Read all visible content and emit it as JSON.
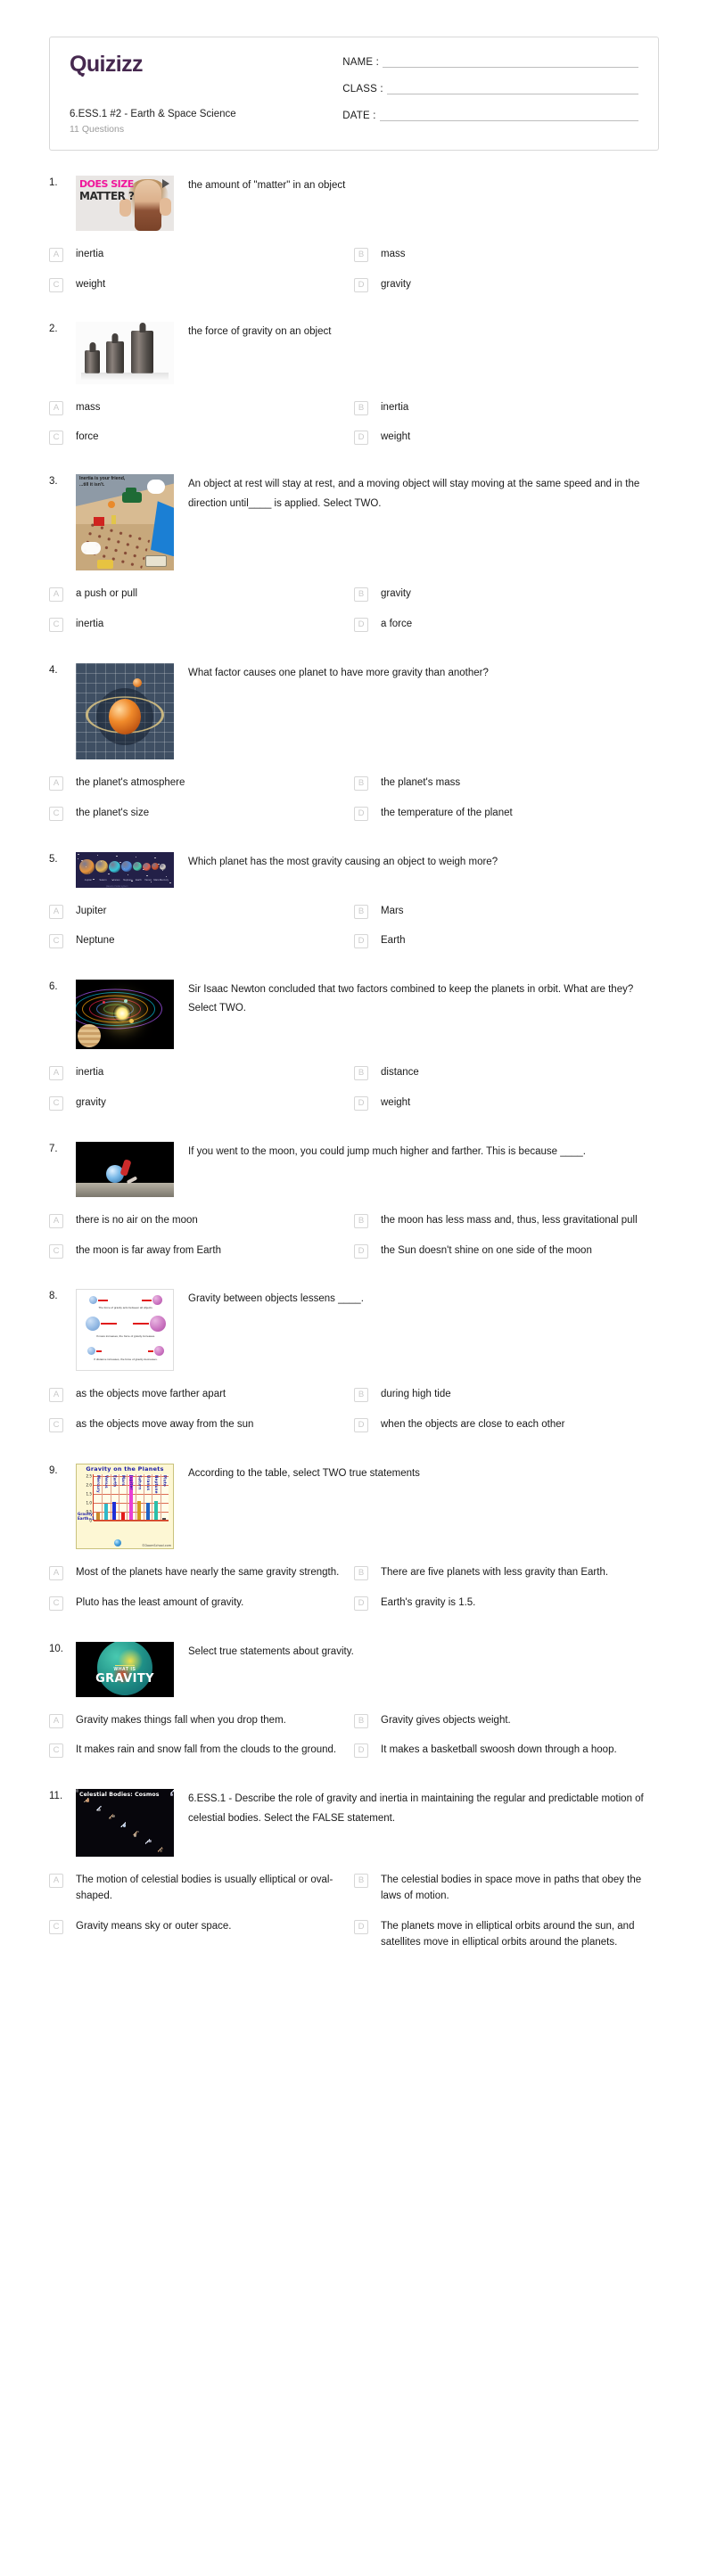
{
  "header": {
    "brand": "Quizizz",
    "quiz_title": "6.ESS.1 #2 - Earth & Space Science",
    "question_count_label": "11 Questions",
    "fields": [
      {
        "label": "NAME :"
      },
      {
        "label": "CLASS :"
      },
      {
        "label": "DATE  :"
      }
    ]
  },
  "questions": [
    {
      "number": "1.",
      "text": "the amount of \"matter\" in an object",
      "media": "does-size-matter-video-thumbnail",
      "options": [
        {
          "key": "A",
          "text": "inertia"
        },
        {
          "key": "B",
          "text": "mass"
        },
        {
          "key": "C",
          "text": "weight"
        },
        {
          "key": "D",
          "text": "gravity"
        }
      ]
    },
    {
      "number": "2.",
      "text": "the force of gravity on an object",
      "media": "calibration-weights-photo",
      "options": [
        {
          "key": "A",
          "text": "mass"
        },
        {
          "key": "B",
          "text": "inertia"
        },
        {
          "key": "C",
          "text": "force"
        },
        {
          "key": "D",
          "text": "weight"
        }
      ]
    },
    {
      "number": "3.",
      "text": "An object at rest will stay at rest, and a moving object will stay moving at the same speed and in the direction until____ is applied. Select TWO.",
      "media": "inertia-is-your-friend-cartoon",
      "media_caption": "Inertia is your friend, ...till it isn't.",
      "options": [
        {
          "key": "A",
          "text": "a push or pull"
        },
        {
          "key": "B",
          "text": "gravity"
        },
        {
          "key": "C",
          "text": "inertia"
        },
        {
          "key": "D",
          "text": "a force"
        }
      ]
    },
    {
      "number": "4.",
      "text": "What factor causes one planet to have more gravity than another?",
      "media": "gravity-well-spacetime-illustration",
      "options": [
        {
          "key": "A",
          "text": "the planet's atmosphere"
        },
        {
          "key": "B",
          "text": "the planet's mass"
        },
        {
          "key": "C",
          "text": "the planet's size"
        },
        {
          "key": "D",
          "text": "the temperature of the planet"
        }
      ]
    },
    {
      "number": "5.",
      "text": "Which planet has the most gravity causing an object to weigh more?",
      "media": "solar-system-planets-strip",
      "options": [
        {
          "key": "A",
          "text": "Jupiter"
        },
        {
          "key": "B",
          "text": "Mars"
        },
        {
          "key": "C",
          "text": "Neptune"
        },
        {
          "key": "D",
          "text": "Earth"
        }
      ]
    },
    {
      "number": "6.",
      "text": "Sir Isaac Newton concluded that two factors combined to keep the planets in orbit. What are they? Select TWO.",
      "media": "planetary-orbits-dark-illustration",
      "options": [
        {
          "key": "A",
          "text": "inertia"
        },
        {
          "key": "B",
          "text": "distance"
        },
        {
          "key": "C",
          "text": "gravity"
        },
        {
          "key": "D",
          "text": "weight"
        }
      ]
    },
    {
      "number": "7.",
      "text": "If you went to the moon, you could jump much higher and farther. This is because ____.",
      "media": "astronaut-jumping-on-moon",
      "options": [
        {
          "key": "A",
          "text": "there is no air on the moon"
        },
        {
          "key": "B",
          "text": "the moon has less mass and, thus, less gravitational pull"
        },
        {
          "key": "C",
          "text": "the moon is far away from Earth"
        },
        {
          "key": "D",
          "text": "the Sun doesn't shine on one side of the moon"
        }
      ]
    },
    {
      "number": "8.",
      "text": "Gravity between objects lessens ____.",
      "media": "force-of-gravity-diagram",
      "media_captions": [
        "The force of gravity acts between all objects.",
        "If mass increases, the force of gravity increases.",
        "If distance increases, the force of gravity decreases."
      ],
      "options": [
        {
          "key": "A",
          "text": "as the objects move farther apart"
        },
        {
          "key": "B",
          "text": "during high tide"
        },
        {
          "key": "C",
          "text": "as the objects move away from the sun"
        },
        {
          "key": "D",
          "text": "when the objects are close to each other"
        }
      ]
    },
    {
      "number": "9.",
      "text": "According to the table, select TWO true statements",
      "media": "gravity-on-the-planets-bar-chart",
      "options": [
        {
          "key": "A",
          "text": "Most of the planets have nearly the same gravity strength."
        },
        {
          "key": "B",
          "text": "There are five planets with less gravity than Earth."
        },
        {
          "key": "C",
          "text": "Pluto has the least amount of gravity."
        },
        {
          "key": "D",
          "text": "Earth's gravity is 1.5."
        }
      ]
    },
    {
      "number": "10.",
      "text": "Select true statements about gravity.",
      "media": "what-is-gravity-video-thumbnail",
      "media_overline": "WHAT IS",
      "media_title": "GRAVITY",
      "options": [
        {
          "key": "A",
          "text": "Gravity makes things fall when you drop them."
        },
        {
          "key": "B",
          "text": "Gravity gives objects weight."
        },
        {
          "key": "C",
          "text": "It makes rain and snow fall from the clouds to the ground."
        },
        {
          "key": "D",
          "text": "It makes a basketball swoosh down through a hoop."
        }
      ]
    },
    {
      "number": "11.",
      "text": "6.ESS.1 - Describe the role of gravity and inertia in maintaining the regular and predictable motion of celestial bodies. Select the FALSE statement.",
      "media": "celestial-bodies-cosmos-thumbnail",
      "media_title": "Celestial Bodies: Cosmos",
      "options": [
        {
          "key": "A",
          "text": "The motion of celestial bodies is usually elliptical or oval-shaped."
        },
        {
          "key": "B",
          "text": "The celestial bodies in space move in paths that obey the laws of motion."
        },
        {
          "key": "C",
          "text": "Gravity means sky or outer space."
        },
        {
          "key": "D",
          "text": "The planets move in elliptical orbits around the sun, and satellites move in elliptical orbits around the planets."
        }
      ]
    }
  ],
  "chart_data": {
    "type": "bar",
    "title": "Gravity on the Planets",
    "xlabel": "Gravity Earth=1",
    "ylabel": "",
    "categories": [
      "Mercury",
      "Venus",
      "Earth",
      "Mars",
      "Jupiter",
      "Saturn",
      "Uranus",
      "Neptune",
      "Pluto"
    ],
    "values": [
      0.38,
      0.9,
      1.0,
      0.38,
      2.5,
      1.06,
      0.92,
      1.05,
      0.06
    ],
    "bar_colors": [
      "#c8892a",
      "#2fb8c9",
      "#1f2fd6",
      "#e41b1b",
      "#e83fd6",
      "#d39b20",
      "#1f62c4",
      "#2bbfaa",
      "#4a4a4a"
    ],
    "yticks": [
      "0",
      "0.5",
      "1.0",
      "1.5",
      "2.0",
      "2.5"
    ],
    "ylim": [
      0,
      2.6
    ],
    "grid": true,
    "legend": "none",
    "credit": "©DoomSchool.com"
  },
  "planet_strip": [
    {
      "name": "Jupiter",
      "color": "#e8943a",
      "size": 17
    },
    {
      "name": "Saturn",
      "color": "#e3b456",
      "size": 14
    },
    {
      "name": "Uranus",
      "color": "#37c6d8",
      "size": 13
    },
    {
      "name": "Neptune",
      "color": "#4f8fe0",
      "size": 12
    },
    {
      "name": "Earth",
      "color": "#46c8a8",
      "size": 10
    },
    {
      "name": "Venus",
      "color": "#e0604a",
      "size": 9
    },
    {
      "name": "Mars",
      "color": "#d0512b",
      "size": 8
    },
    {
      "name": "Mercury",
      "color": "#d8d2c6",
      "size": 7
    }
  ]
}
